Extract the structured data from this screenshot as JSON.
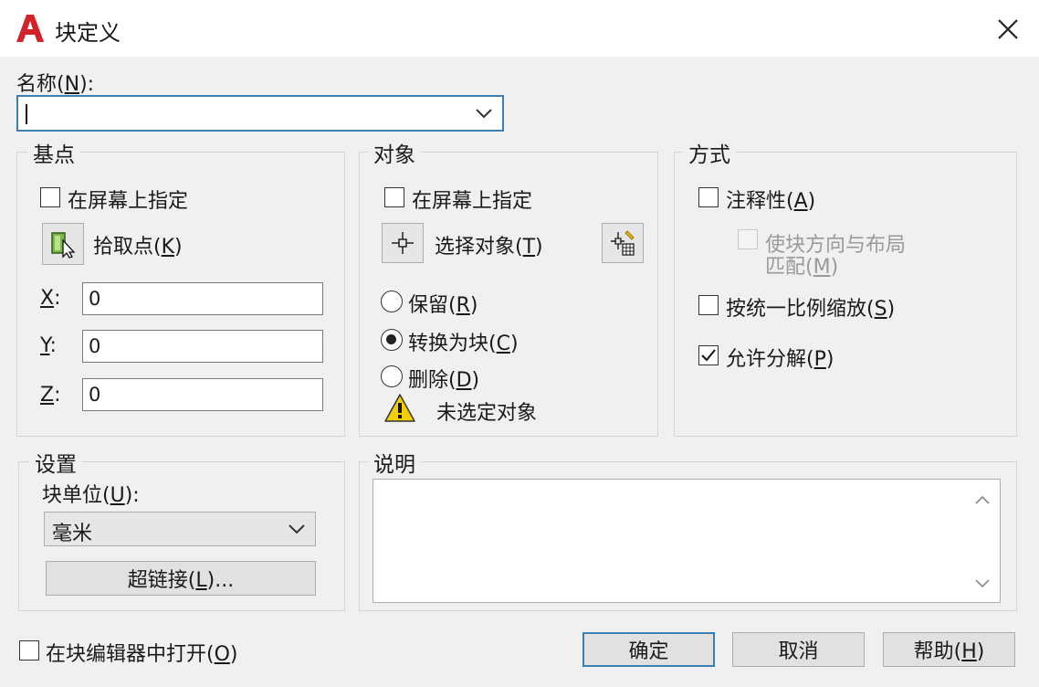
{
  "window": {
    "title": "块定义"
  },
  "name_field": {
    "label_pre": "名称(",
    "label_key": "N",
    "label_post": "):",
    "value": ""
  },
  "base_point": {
    "title": "基点",
    "specify_on_screen": "在屏幕上指定",
    "pick_point_pre": "拾取点(",
    "pick_point_key": "K",
    "pick_point_post": ")",
    "x_key": "X",
    "x_value": "0",
    "y_key": "Y",
    "y_value": "0",
    "z_key": "Z",
    "z_value": "0",
    "axis_suffix": ":"
  },
  "objects": {
    "title": "对象",
    "specify_on_screen": "在屏幕上指定",
    "select_objects_pre": "选择对象(",
    "select_objects_key": "T",
    "select_objects_post": ")",
    "retain_pre": "保留(",
    "retain_key": "R",
    "retain_post": ")",
    "convert_pre": "转换为块(",
    "convert_key": "C",
    "convert_post": ")",
    "delete_pre": "删除(",
    "delete_key": "D",
    "delete_post": ")",
    "selected_option": "convert",
    "warning": "未选定对象"
  },
  "behavior": {
    "title": "方式",
    "annotative_pre": "注释性(",
    "annotative_key": "A",
    "annotative_post": ")",
    "match_line1": "使块方向与布局",
    "match_line2_pre": "匹配(",
    "match_line2_key": "M",
    "match_line2_post": ")",
    "scale_pre": "按统一比例缩放(",
    "scale_key": "S",
    "scale_post": ")",
    "explode_pre": "允许分解(",
    "explode_key": "P",
    "explode_post": ")",
    "explode_checked": true
  },
  "settings": {
    "title": "设置",
    "unit_label_pre": "块单位(",
    "unit_label_key": "U",
    "unit_label_post": "):",
    "unit_value": "毫米",
    "hyperlink_pre": "超链接(",
    "hyperlink_key": "L",
    "hyperlink_post": ")..."
  },
  "description": {
    "title": "说明",
    "value": ""
  },
  "footer": {
    "open_editor_pre": "在块编辑器中打开(",
    "open_editor_key": "O",
    "open_editor_post": ")",
    "ok": "确定",
    "cancel": "取消",
    "help_pre": "帮助(",
    "help_key": "H",
    "help_post": ")"
  },
  "colors": {
    "accent": "#3c7fb1",
    "logo_red": "#d2232a",
    "warning_yellow": "#f5d000"
  }
}
